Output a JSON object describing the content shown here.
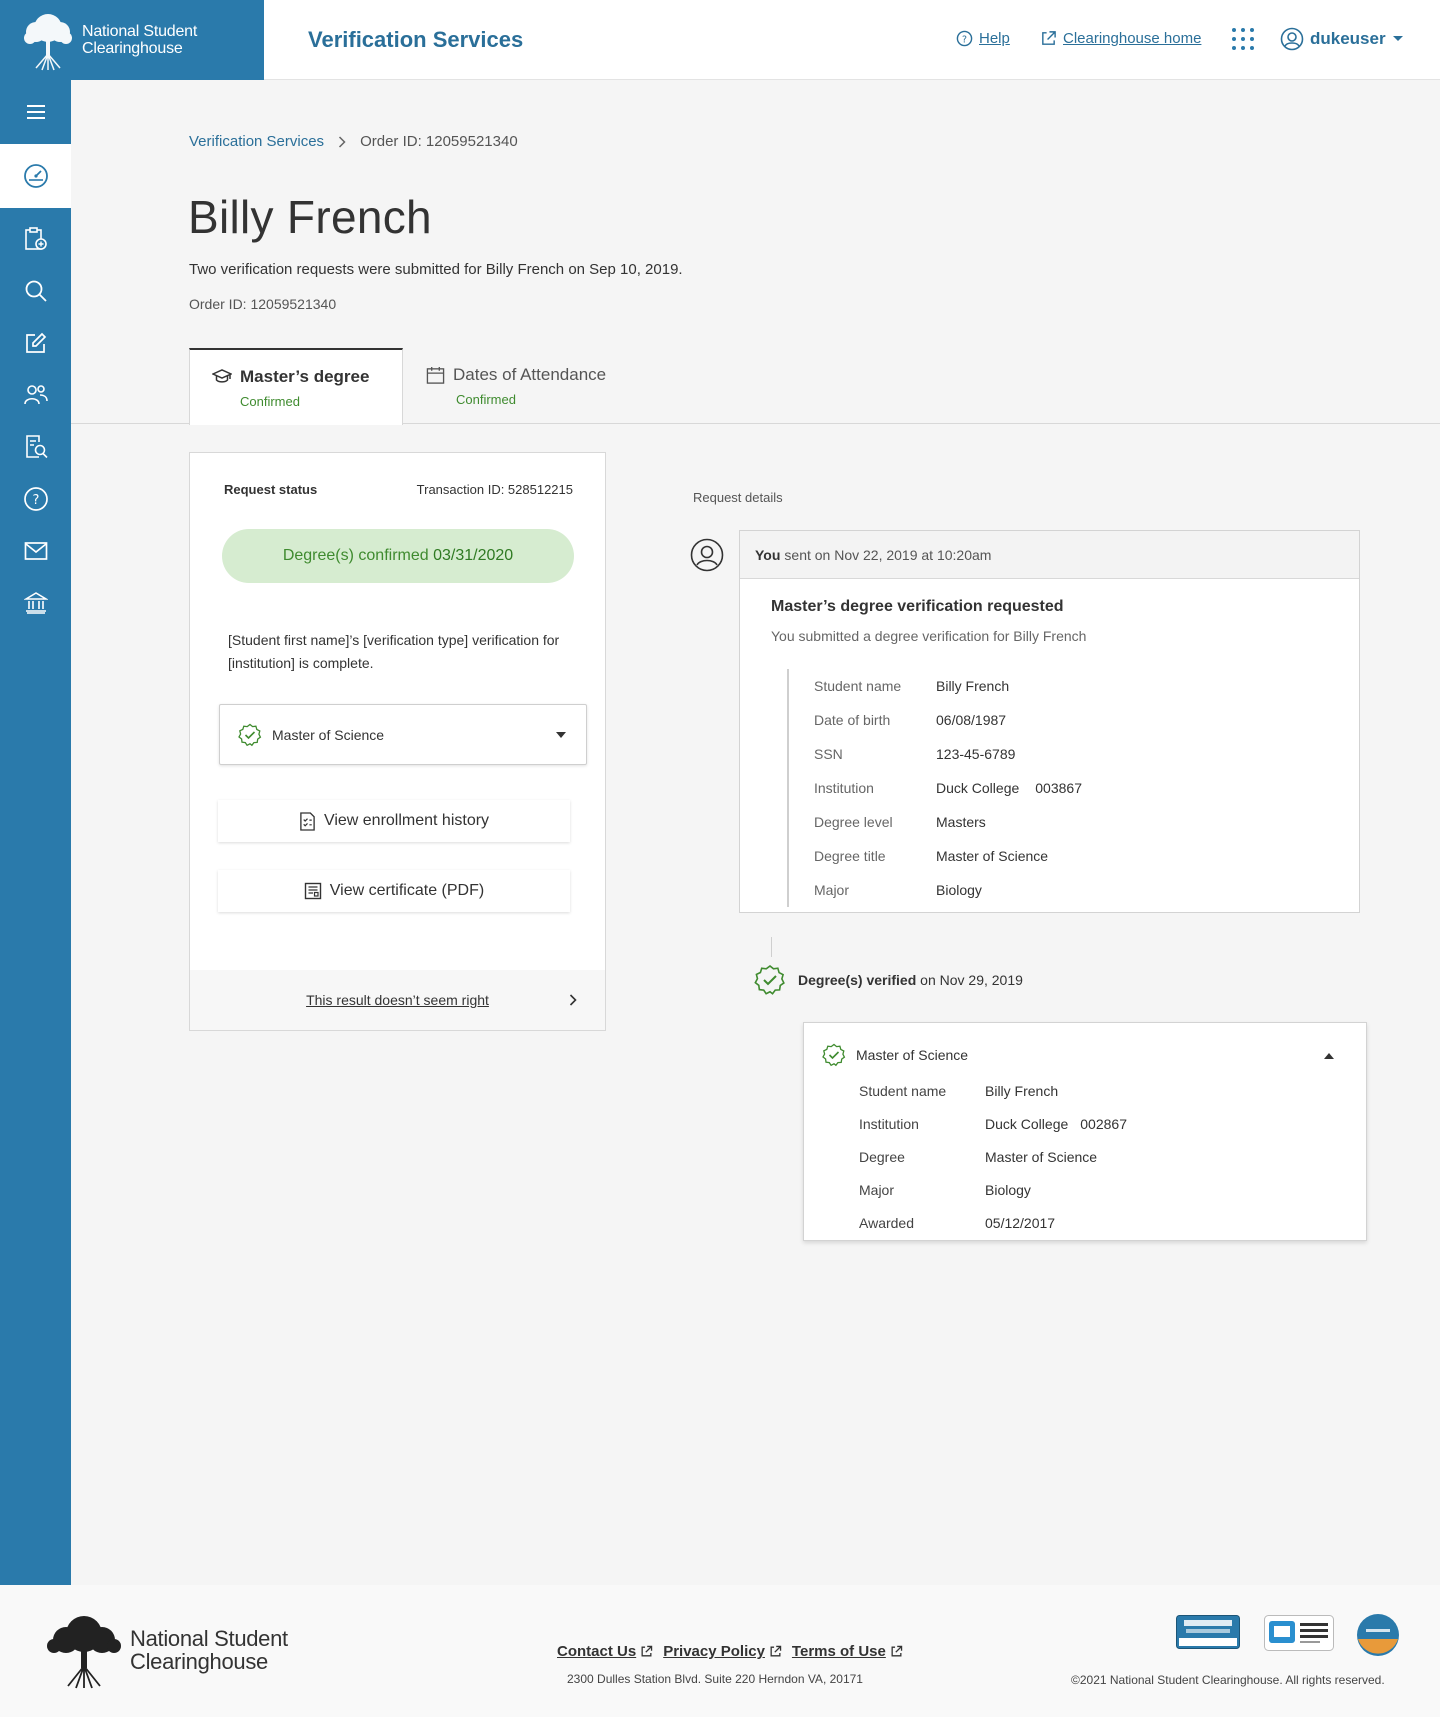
{
  "header": {
    "org_name_line1": "National Student",
    "org_name_line2": "Clearinghouse",
    "app_title": "Verification Services",
    "help_label": "Help",
    "home_label": "Clearinghouse home",
    "username": "dukeuser"
  },
  "sidebar": {
    "items": [
      "menu-icon",
      "dashboard-icon",
      "new-request-icon",
      "search-icon",
      "edit-icon",
      "people-icon",
      "document-search-icon",
      "help-icon",
      "mail-icon",
      "institution-icon"
    ]
  },
  "breadcrumb": {
    "root": "Verification Services",
    "current": "Order ID: 12059521340"
  },
  "page": {
    "title": "Billy French",
    "subtitle": "Two verification requests were submitted for Billy French on Sep 10, 2019.",
    "order_id": "Order ID: 12059521340"
  },
  "tabs": [
    {
      "label": "Master’s degree",
      "status": "Confirmed",
      "icon": "graduation-cap-icon"
    },
    {
      "label": "Dates of Attendance",
      "status": "Confirmed",
      "icon": "calendar-icon"
    }
  ],
  "status_card": {
    "label": "Request status",
    "transaction": "Transaction ID: 528512215",
    "pill_text": "Degree(s) confirmed",
    "pill_date": "03/31/2020",
    "message": "[Student first name]’s [verification type] verification for [institution] is complete.",
    "degree_select": "Master of Science",
    "btn_enrollment": "View enrollment history",
    "btn_certificate": "View certificate (PDF)",
    "footer_link": "This result doesn’t seem right"
  },
  "request_details": {
    "label": "Request details",
    "sender": "You",
    "sent_text": "sent on Nov 22, 2019 at 10:20am",
    "title": "Master’s degree verification requested",
    "subtitle": "You submitted a degree verification for Billy French",
    "rows": [
      {
        "k": "Student name",
        "v": "Billy French",
        "code": ""
      },
      {
        "k": "Date of birth",
        "v": "06/08/1987",
        "code": ""
      },
      {
        "k": "SSN",
        "v": "123-45-6789",
        "code": ""
      },
      {
        "k": "Institution",
        "v": "Duck College",
        "code": "003867"
      },
      {
        "k": "Degree level",
        "v": "Masters",
        "code": ""
      },
      {
        "k": "Degree title",
        "v": "Master of Science",
        "code": ""
      },
      {
        "k": "Major",
        "v": "Biology",
        "code": ""
      }
    ]
  },
  "verification": {
    "label": "Degree(s) verified",
    "when": "on Nov 29, 2019",
    "result_title": "Master of Science",
    "rows": [
      {
        "k": "Student name",
        "v": "Billy French",
        "code": ""
      },
      {
        "k": "Institution",
        "v": "Duck College",
        "code": "002867"
      },
      {
        "k": "Degree",
        "v": "Master of Science",
        "code": ""
      },
      {
        "k": "Major",
        "v": "Biology",
        "code": ""
      },
      {
        "k": "Awarded",
        "v": "05/12/2017",
        "code": ""
      }
    ]
  },
  "footer": {
    "org_line1": "National Student",
    "org_line2": "Clearinghouse",
    "links": [
      "Contact Us",
      "Privacy Policy",
      "Terms of Use"
    ],
    "address": "2300 Dulles Station Blvd. Suite 220 Herndon VA, 20171",
    "copyright": "©2021 National Student Clearinghouse. All rights reserved.",
    "badges": [
      "securetrust-badge",
      "student-privacy-pledge-badge",
      "student-data-principles-badge"
    ]
  },
  "colors": {
    "brand": "#2a7aab",
    "link": "#2a6f99",
    "success": "#3f8b2f",
    "success_bg": "#d6ecd0"
  }
}
